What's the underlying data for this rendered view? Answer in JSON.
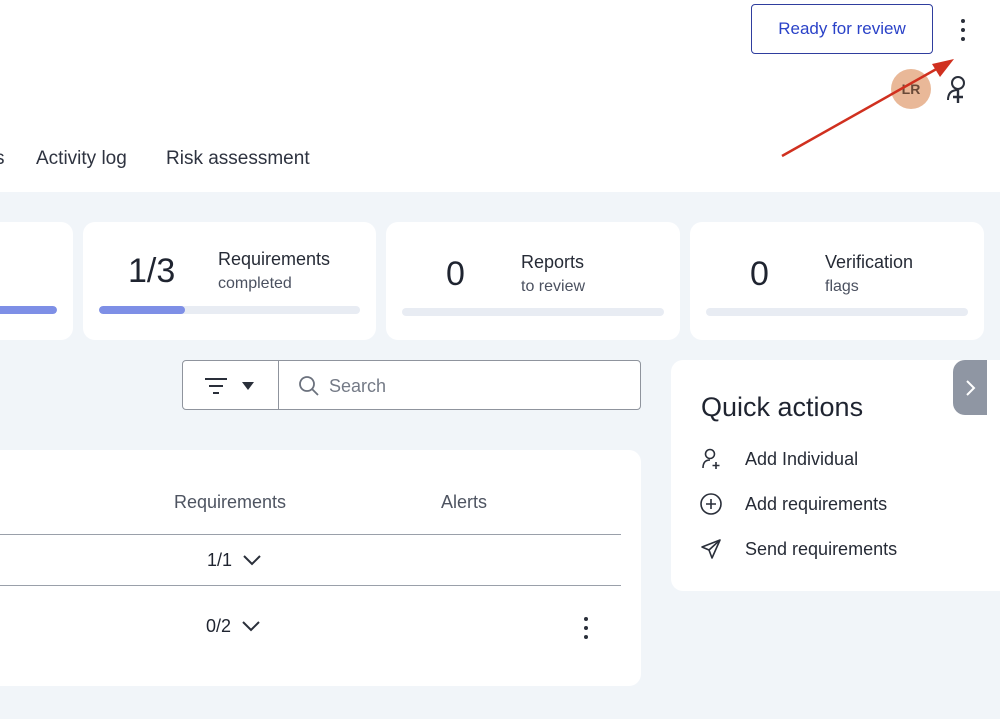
{
  "header": {
    "ready_button": "Ready for review",
    "avatar_initials": "LR",
    "icons": [
      "more-vertical-icon",
      "add-person-icon"
    ]
  },
  "tabs": [
    {
      "label": "s"
    },
    {
      "label": "Activity log"
    },
    {
      "label": "Risk assessment"
    }
  ],
  "stats": [
    {
      "value": "",
      "label": "",
      "sub": "",
      "progress": 1.0
    },
    {
      "value": "1/3",
      "label": "Requirements",
      "sub": "completed",
      "progress": 0.33
    },
    {
      "value": "0",
      "label": "Reports",
      "sub": "to review",
      "progress": 0
    },
    {
      "value": "0",
      "label": "Verification",
      "sub": "flags",
      "progress": 0
    }
  ],
  "toolbar": {
    "filter_icon": "filter-icon",
    "search_placeholder": "Search"
  },
  "table": {
    "columns": [
      "Requirements",
      "Alerts"
    ],
    "rows": [
      {
        "requirements": "1/1"
      },
      {
        "requirements": "0/2"
      }
    ]
  },
  "quick_actions": {
    "title": "Quick actions",
    "items": [
      {
        "label": "Add Individual",
        "icon": "add-person-icon"
      },
      {
        "label": "Add requirements",
        "icon": "plus-circle-icon"
      },
      {
        "label": "Send requirements",
        "icon": "send-icon"
      }
    ]
  },
  "colors": {
    "accent": "#2a42c8",
    "progress_fill": "#7e8fe6",
    "annotation_arrow": "#d0301f",
    "background": "#f1f5f9"
  }
}
